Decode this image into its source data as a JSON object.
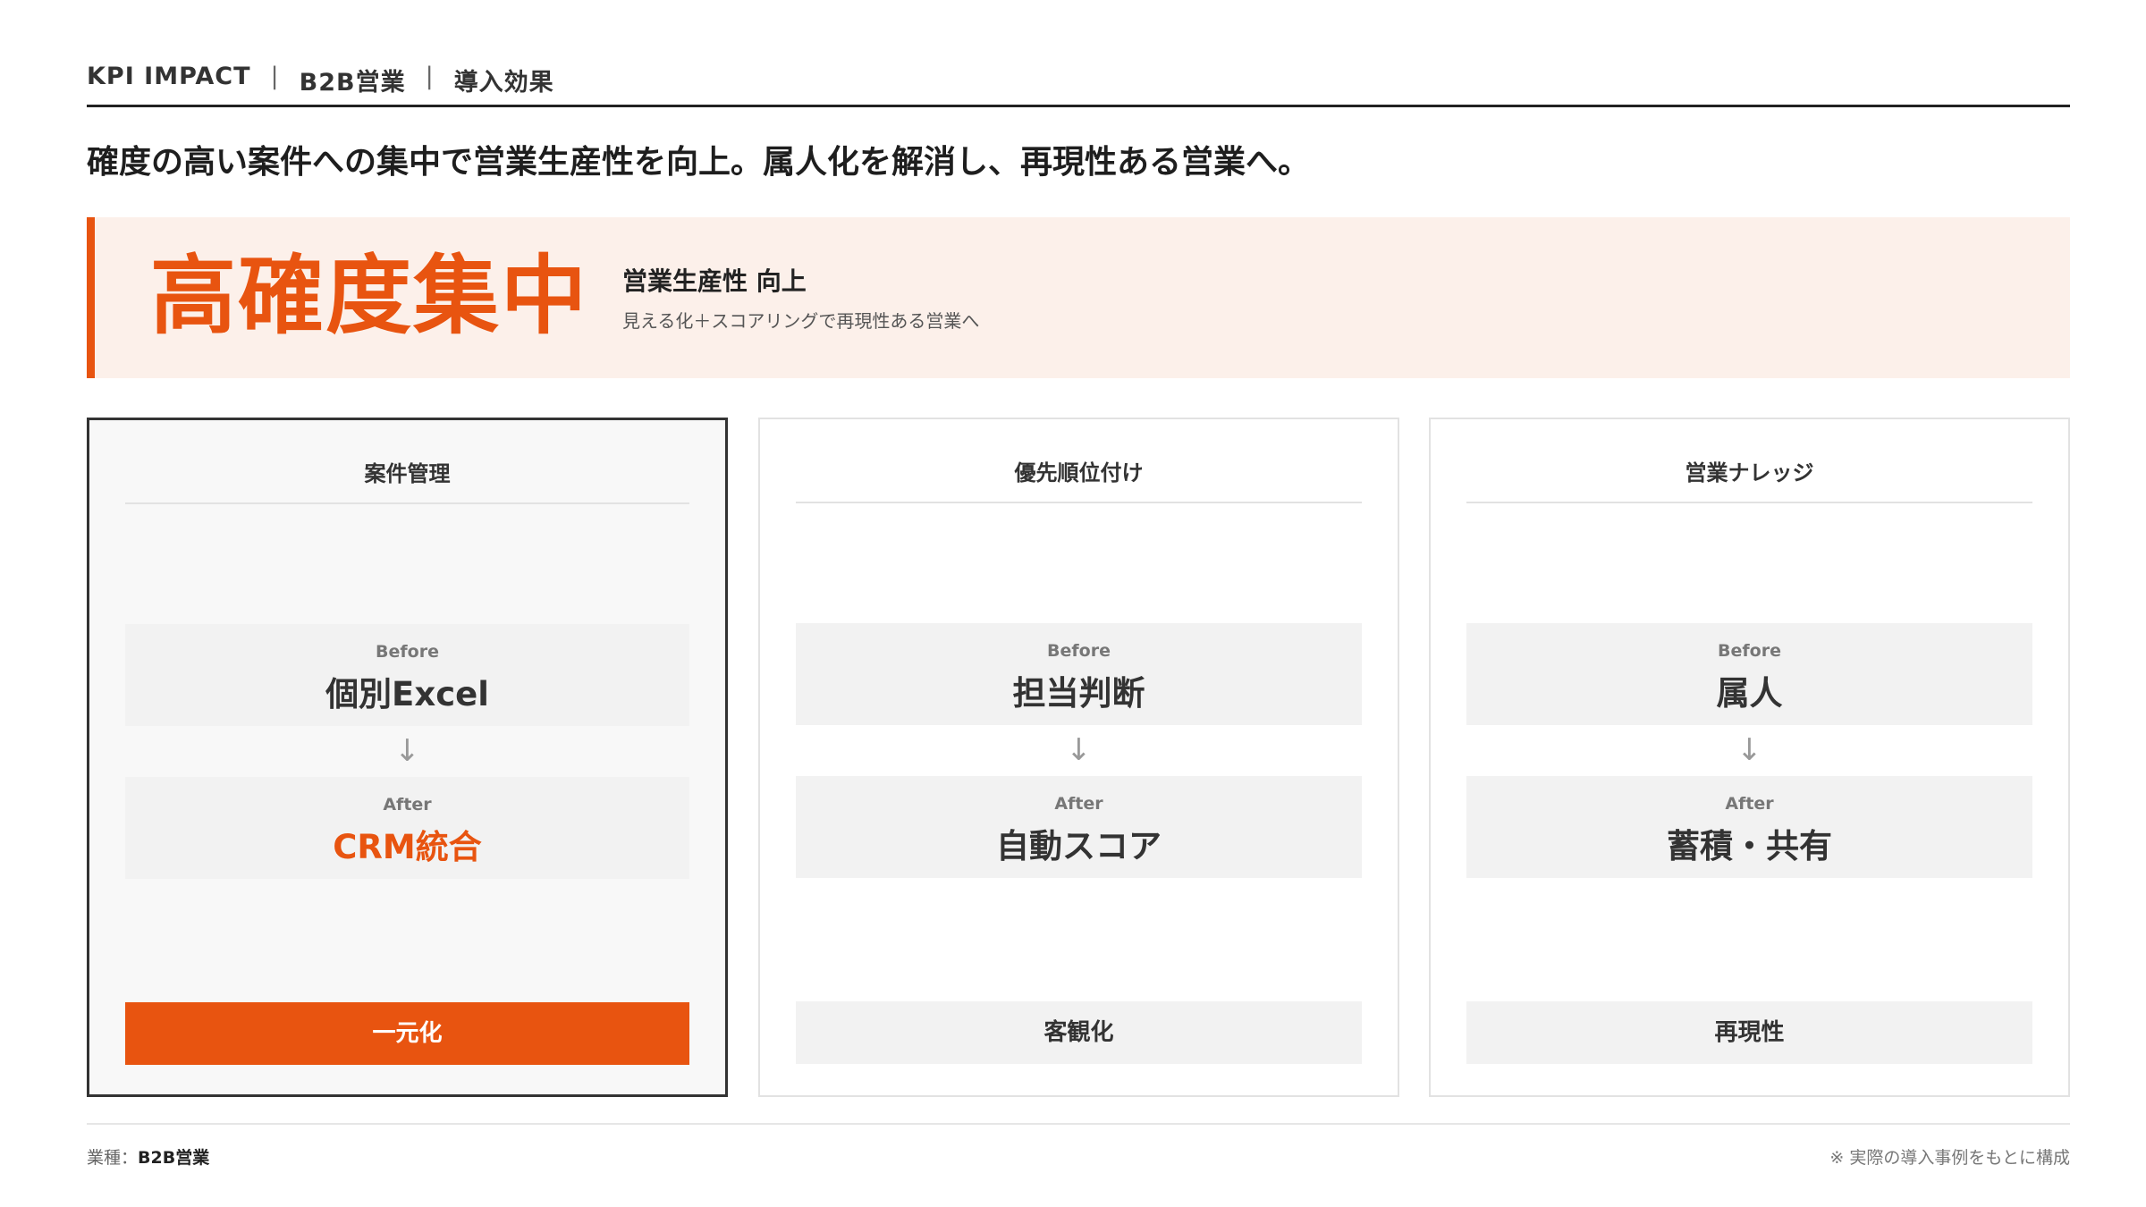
{
  "header": {
    "items": [
      "KPI IMPACT",
      "B2B営業",
      "導入効果"
    ],
    "separator": "|"
  },
  "headline": "確度の高い案件への集中で営業生産性を向上。属人化を解消し、再現性ある営業へ。",
  "hero": {
    "title": "高確度集中",
    "subtitle": "営業生産性 向上",
    "description": "見える化＋スコアリングで再現性ある営業へ"
  },
  "cards": [
    {
      "title": "案件管理",
      "before_label": "Before",
      "before_value": "個別Excel",
      "arrow": "↓",
      "after_label": "After",
      "after_value": "CRM統合",
      "result": "一元化"
    },
    {
      "title": "優先順位付け",
      "before_label": "Before",
      "before_value": "担当判断",
      "arrow": "↓",
      "after_label": "After",
      "after_value": "自動スコア",
      "result": "客観化"
    },
    {
      "title": "営業ナレッジ",
      "before_label": "Before",
      "before_value": "属人",
      "arrow": "↓",
      "after_label": "After",
      "after_value": "蓄積・共有",
      "result": "再現性"
    }
  ],
  "footer": {
    "industry_label": "業種：",
    "industry_value": "B2B営業",
    "note": "※ 実際の導入事例をもとに構成"
  },
  "colors": {
    "accent": "#e85410",
    "hero_bg": "#fcf0ea",
    "box_bg": "#f2f2f2",
    "text_dark": "#222222"
  }
}
